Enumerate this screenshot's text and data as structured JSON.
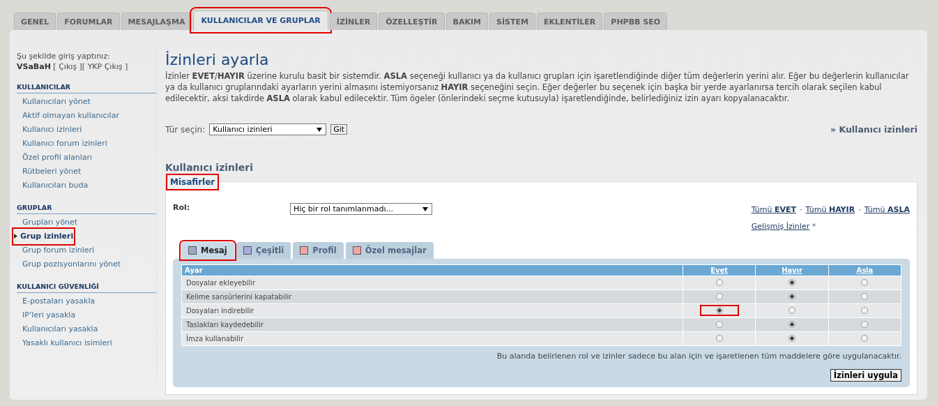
{
  "tabs": [
    {
      "label": "GENEL",
      "selected": false,
      "highlighted": false
    },
    {
      "label": "FORUMLAR",
      "selected": false,
      "highlighted": false
    },
    {
      "label": "MESAJLAŞMA",
      "selected": false,
      "highlighted": false
    },
    {
      "label": "KULLANICILAR VE GRUPLAR",
      "selected": true,
      "highlighted": true
    },
    {
      "label": "İZİNLER",
      "selected": false,
      "highlighted": false
    },
    {
      "label": "ÖZELLEŞTİR",
      "selected": false,
      "highlighted": false
    },
    {
      "label": "BAKIM",
      "selected": false,
      "highlighted": false
    },
    {
      "label": "SİSTEM",
      "selected": false,
      "highlighted": false
    },
    {
      "label": "EKLENTİLER",
      "selected": false,
      "highlighted": false
    },
    {
      "label": "PHPBB SEO",
      "selected": false,
      "highlighted": false
    }
  ],
  "sidebar": {
    "login_text": "Şu şekilde giriş yaptınız:",
    "username": "VSaBaH",
    "logout_links": "[ Çıkış ][ YKP Çıkış ]",
    "sections": [
      {
        "title": "KULLANICILAR",
        "items": [
          {
            "label": "Kullanıcıları yönet",
            "selected": false,
            "highlighted": false
          },
          {
            "label": "Aktif olmayan kullanıcılar",
            "selected": false,
            "highlighted": false
          },
          {
            "label": "Kullanıcı izinleri",
            "selected": false,
            "highlighted": false
          },
          {
            "label": "Kullanıcı forum izinleri",
            "selected": false,
            "highlighted": false
          },
          {
            "label": "Özel profil alanları",
            "selected": false,
            "highlighted": false
          },
          {
            "label": "Rütbeleri yönet",
            "selected": false,
            "highlighted": false
          },
          {
            "label": "Kullanıcıları buda",
            "selected": false,
            "highlighted": false
          }
        ]
      },
      {
        "title": "GRUPLAR",
        "items": [
          {
            "label": "Grupları yönet",
            "selected": false,
            "highlighted": false
          },
          {
            "label": "Grup izinleri",
            "selected": true,
            "highlighted": true
          },
          {
            "label": "Grup forum izinleri",
            "selected": false,
            "highlighted": false
          },
          {
            "label": "Grup pozisyonlarını yönet",
            "selected": false,
            "highlighted": false
          }
        ]
      },
      {
        "title": "KULLANICI GÜVENLİĞİ",
        "items": [
          {
            "label": "E-postaları yasakla",
            "selected": false,
            "highlighted": false
          },
          {
            "label": "IP’leri yasakla",
            "selected": false,
            "highlighted": false
          },
          {
            "label": "Kullanıcıları yasakla",
            "selected": false,
            "highlighted": false
          },
          {
            "label": "Yasaklı kullanıcı isimleri",
            "selected": false,
            "highlighted": false
          }
        ]
      }
    ]
  },
  "page": {
    "title": "İzinleri ayarla",
    "description": "İzinler **EVET**/**HAYIR** üzerine kurulu basit bir sistemdir. **ASLA** seçeneği kullanıcı ya da kullanıcı grupları için işaretlendiğinde diğer tüm değerlerin yerini alır. Eğer bu değerlerin kullanıcılar ya da kullanıcı gruplarındaki ayarların yerini almasını istemiyorsanız **HAYIR** seçeneğini seçin. Eğer değerler bu seçenek için başka bir yerde ayarlanırsa tercih olarak seçilen kabul edilecektir, aksi takdirde **ASLA** olarak kabul edilecektir. Tüm ögeler (önlerindeki seçme kutusuyla) işaretlendiğinde, belirlediğiniz izin ayarı kopyalanacaktır.",
    "type_label": "Tür seçin:",
    "type_select": "Kullanıcı izinleri",
    "go_button": "Git",
    "type_link": "» Kullanıcı izinleri",
    "section_title": "Kullanıcı izinleri"
  },
  "permissions": {
    "legend": "Misafirler",
    "legend_highlighted": true,
    "role_label": "Rol:",
    "role_select": "Hiç bir rol tanımlanmadı...",
    "link_separator": "·",
    "all_links": [
      {
        "prefix": "Tümü",
        "value": "EVET"
      },
      {
        "prefix": "Tümü",
        "value": "HAYIR"
      },
      {
        "prefix": "Tümü",
        "value": "ASLA"
      }
    ],
    "advanced_link": "Gelişmiş İzinler",
    "advanced_mark": "*",
    "category_tabs": [
      {
        "label": "Mesaj",
        "color": "#a2a6c4",
        "selected": true,
        "highlighted": true
      },
      {
        "label": "Çeşitli",
        "color": "#a9acdf",
        "selected": false,
        "highlighted": false
      },
      {
        "label": "Profil",
        "color": "#f0a3a3",
        "selected": false,
        "highlighted": false
      },
      {
        "label": "Özel mesajlar",
        "color": "#f0a3a3",
        "selected": false,
        "highlighted": false
      }
    ],
    "table": {
      "columns": [
        "Ayar",
        "Evet",
        "Hayır",
        "Asla"
      ],
      "rows": [
        {
          "label": "Dosyalar ekleyebilir",
          "options": [
            {
              "selected": false,
              "highlighted": false
            },
            {
              "selected": true,
              "highlighted": false
            },
            {
              "selected": false,
              "highlighted": false
            }
          ]
        },
        {
          "label": "Kelime sansürlerini kapatabilir",
          "options": [
            {
              "selected": false,
              "highlighted": false
            },
            {
              "selected": true,
              "highlighted": false
            },
            {
              "selected": false,
              "highlighted": false
            }
          ]
        },
        {
          "label": "Dosyaları indirebilir",
          "options": [
            {
              "selected": true,
              "highlighted": true
            },
            {
              "selected": false,
              "highlighted": false
            },
            {
              "selected": false,
              "highlighted": false
            }
          ]
        },
        {
          "label": "Taslakları kaydedebilir",
          "options": [
            {
              "selected": false,
              "highlighted": false
            },
            {
              "selected": true,
              "highlighted": false
            },
            {
              "selected": false,
              "highlighted": false
            }
          ]
        },
        {
          "label": "İmza kullanabilir",
          "options": [
            {
              "selected": false,
              "highlighted": false
            },
            {
              "selected": true,
              "highlighted": false
            },
            {
              "selected": false,
              "highlighted": false
            }
          ]
        }
      ]
    },
    "note": "Bu alanda belirlenen rol ve izinler sadece bu alan için ve işaretlenen tüm maddelere göre uygulanacaktır.",
    "apply_button": "İzinleri uygula"
  }
}
